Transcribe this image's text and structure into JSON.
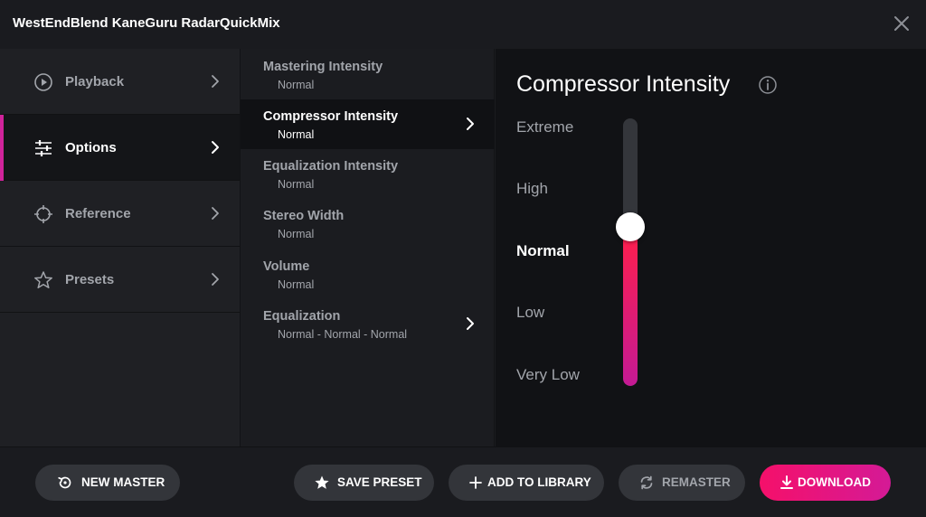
{
  "window": {
    "title": "WestEndBlend KaneGuru RadarQuickMix"
  },
  "sidebar": {
    "items": [
      {
        "label": "Playback",
        "icon": "play-circle-icon",
        "active": false
      },
      {
        "label": "Options",
        "icon": "sliders-icon",
        "active": true
      },
      {
        "label": "Reference",
        "icon": "crosshair-icon",
        "active": false
      },
      {
        "label": "Presets",
        "icon": "star-icon",
        "active": false
      }
    ]
  },
  "options": {
    "items": [
      {
        "label": "Mastering Intensity",
        "value": "Normal",
        "active": false,
        "has_chevron": false
      },
      {
        "label": "Compressor Intensity",
        "value": "Normal",
        "active": true,
        "has_chevron": true
      },
      {
        "label": "Equalization Intensity",
        "value": "Normal",
        "active": false,
        "has_chevron": false
      },
      {
        "label": "Stereo Width",
        "value": "Normal",
        "active": false,
        "has_chevron": false
      },
      {
        "label": "Volume",
        "value": "Normal",
        "active": false,
        "has_chevron": false
      },
      {
        "label": "Equalization",
        "value": "Normal - Normal - Normal",
        "active": false,
        "has_chevron": true
      }
    ]
  },
  "detail": {
    "title": "Compressor Intensity",
    "levels": [
      "Extreme",
      "High",
      "Normal",
      "Low",
      "Very Low"
    ],
    "selected": "Normal",
    "slider_value_fraction": 0.5
  },
  "footer": {
    "new_master": "NEW MASTER",
    "save_preset": "SAVE PRESET",
    "add_to_library": "ADD TO LIBRARY",
    "remaster": "REMASTER",
    "download": "DOWNLOAD"
  },
  "colors": {
    "accent": "#d0239a",
    "slider_top": "#ff1f4a",
    "slider_bottom": "#c41a94",
    "download_start": "#f5106a",
    "download_end": "#d41a96"
  }
}
